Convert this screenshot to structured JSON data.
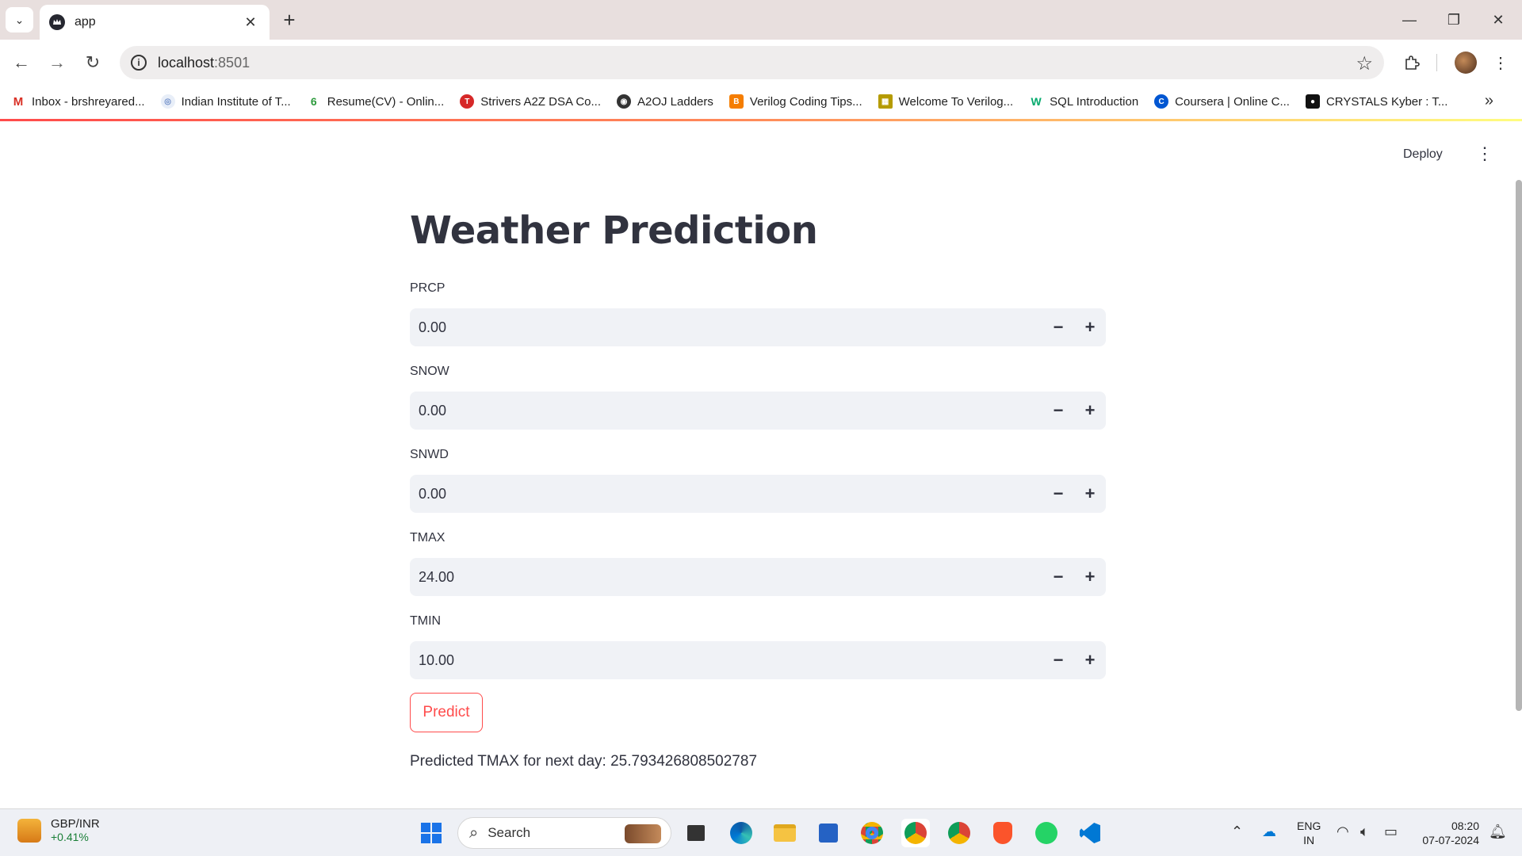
{
  "browser": {
    "tab_title": "app",
    "url_host": "localhost",
    "url_port": ":8501",
    "bookmarks": [
      {
        "label": "Inbox - brshreyared...",
        "icon": "gmail-icon",
        "color": "#d93025",
        "glyph": "M"
      },
      {
        "label": "Indian Institute of T...",
        "icon": "iit-logo-icon",
        "color": "#6d8cc7",
        "glyph": "◎"
      },
      {
        "label": "Resume(CV) - Onlin...",
        "icon": "resume-icon",
        "color": "#2e9b3e",
        "glyph": "6"
      },
      {
        "label": "Strivers A2Z DSA Co...",
        "icon": "tuf-icon",
        "color": "#d62828",
        "glyph": "T"
      },
      {
        "label": "A2OJ Ladders",
        "icon": "globe-icon",
        "color": "#333333",
        "glyph": "◉"
      },
      {
        "label": "Verilog Coding Tips...",
        "icon": "blogger-icon",
        "color": "#f57d00",
        "glyph": "B"
      },
      {
        "label": "Welcome To Verilog...",
        "icon": "verilog-icon",
        "color": "#b59b00",
        "glyph": "▦"
      },
      {
        "label": "SQL Introduction",
        "icon": "w3schools-icon",
        "color": "#04aa6d",
        "glyph": "W"
      },
      {
        "label": "Coursera | Online C...",
        "icon": "coursera-icon",
        "color": "#0056d2",
        "glyph": "C"
      },
      {
        "label": "CRYSTALS Kyber : T...",
        "icon": "medium-icon",
        "color": "#111111",
        "glyph": "●"
      }
    ]
  },
  "app": {
    "deploy_label": "Deploy",
    "title": "Weather Prediction",
    "fields": [
      {
        "label": "PRCP",
        "value": "0.00"
      },
      {
        "label": "SNOW",
        "value": "0.00"
      },
      {
        "label": "SNWD",
        "value": "0.00"
      },
      {
        "label": "TMAX",
        "value": "24.00"
      },
      {
        "label": "TMIN",
        "value": "10.00"
      }
    ],
    "predict_label": "Predict",
    "result_text": "Predicted TMAX for next day: 25.793426808502787",
    "accent_color": "#ff4b4b"
  },
  "taskbar": {
    "ticker_name": "GBP/INR",
    "ticker_change": "+0.41%",
    "search_placeholder": "Search",
    "lang_line1": "ENG",
    "lang_line2": "IN",
    "time": "08:20",
    "date": "07-07-2024"
  }
}
